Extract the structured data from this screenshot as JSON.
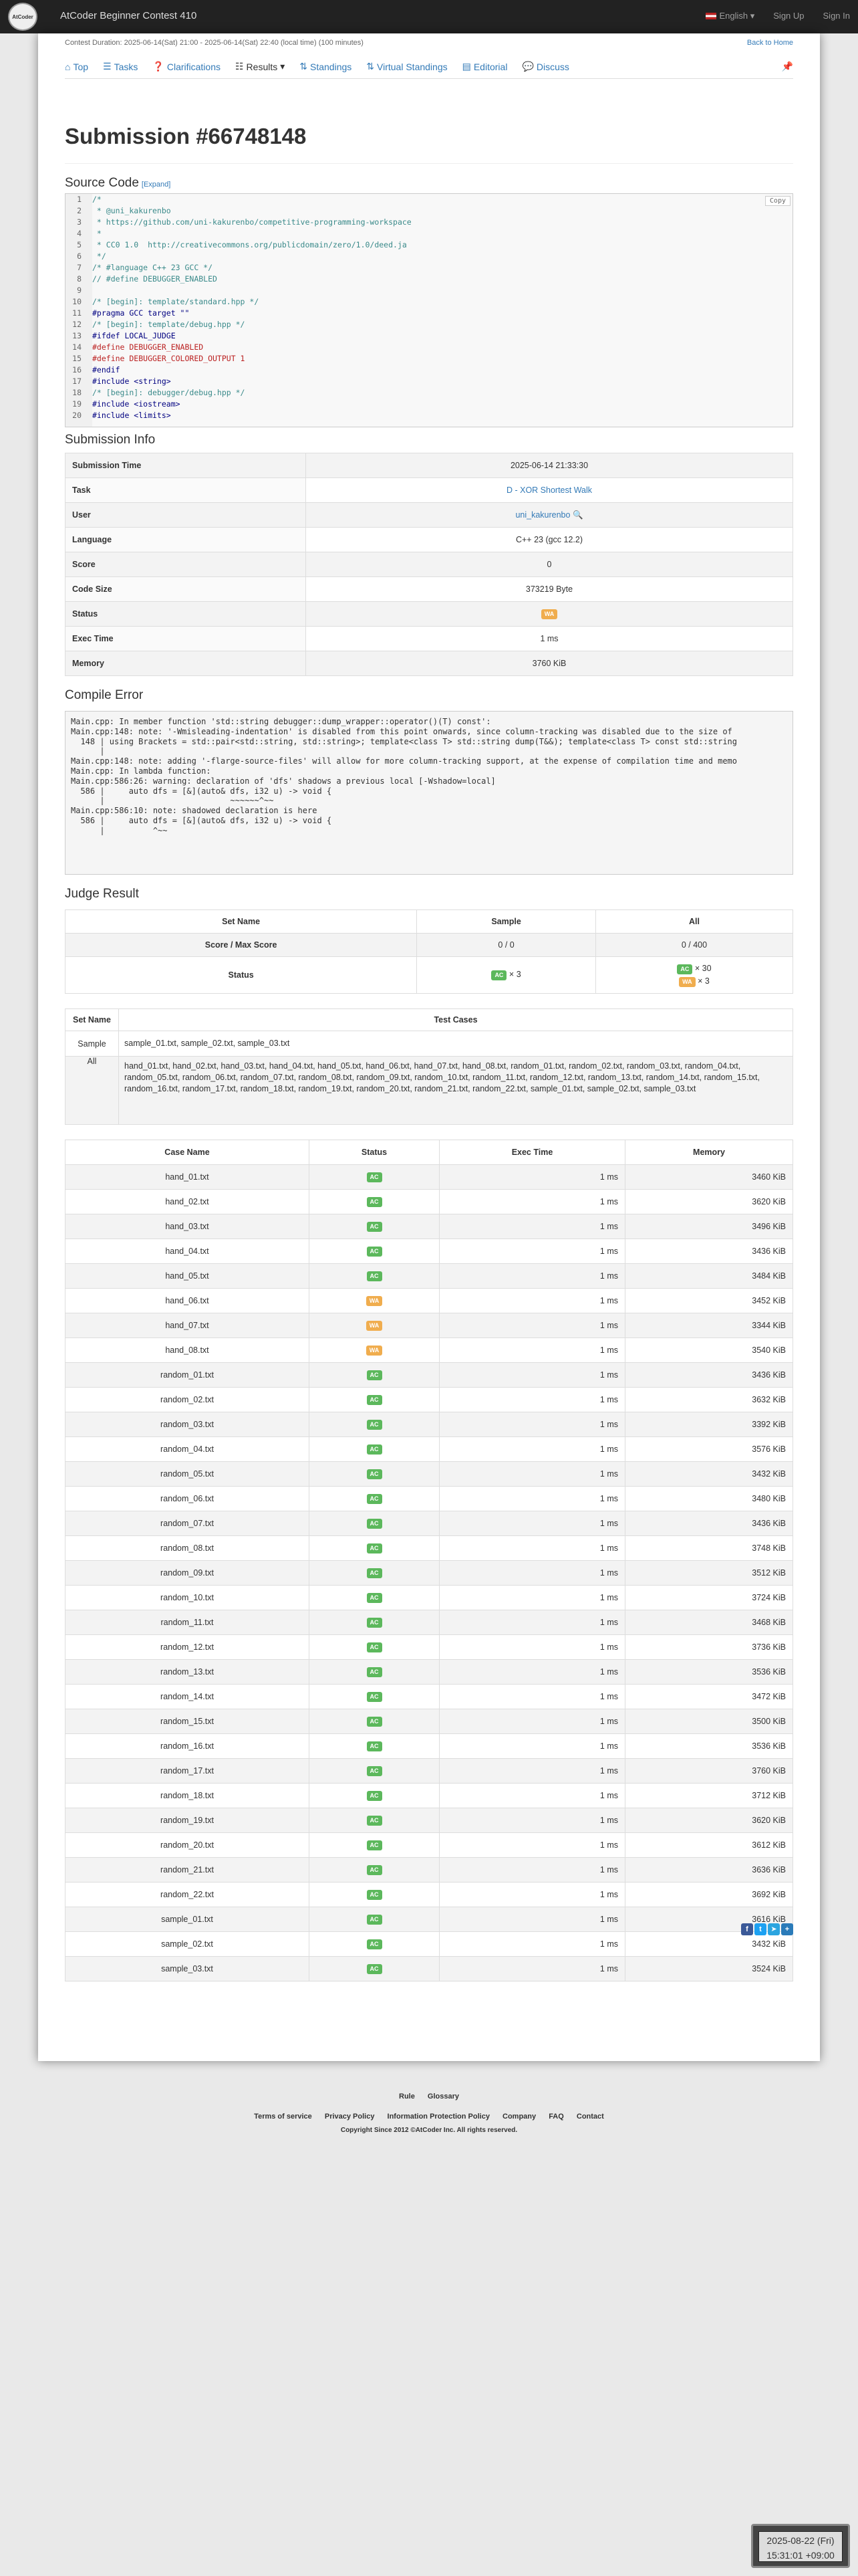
{
  "navbar": {
    "logo_text": "AtCoder",
    "contest_title": "AtCoder Beginner Contest 410",
    "language": "English",
    "sign_up": "Sign Up",
    "sign_in": "Sign In"
  },
  "header": {
    "duration": "Contest Duration: 2025-06-14(Sat) 21:00 - 2025-06-14(Sat) 22:40 (local time) (100 minutes)",
    "back_home": "Back to Home"
  },
  "tabs": [
    "Top",
    "Tasks",
    "Clarifications",
    "Results",
    "Standings",
    "Virtual Standings",
    "Editorial",
    "Discuss"
  ],
  "title": "Submission #66748148",
  "source_code": {
    "heading": "Source Code",
    "expand": "[Expand]",
    "copy": "Copy",
    "lines": [
      "/*",
      " * @uni_kakurenbo",
      " * https://github.com/uni-kakurenbo/competitive-programming-workspace",
      " *",
      " * CC0 1.0  http://creativecommons.org/publicdomain/zero/1.0/deed.ja",
      " */",
      "/* #language C++ 23 GCC */",
      "// #define DEBUGGER_ENABLED",
      "",
      "/* [begin]: template/standard.hpp */",
      "#pragma GCC target \"\"",
      "/* [begin]: template/debug.hpp */",
      "#ifdef LOCAL_JUDGE",
      "#define DEBUGGER_ENABLED",
      "#define DEBUGGER_COLORED_OUTPUT 1",
      "#endif",
      "#include <string>",
      "/* [begin]: debugger/debug.hpp */",
      "#include <iostream>",
      "#include <limits>"
    ]
  },
  "submission_info": {
    "heading": "Submission Info",
    "rows": [
      {
        "label": "Submission Time",
        "value": "2025-06-14 21:33:30"
      },
      {
        "label": "Task",
        "value": "D - XOR Shortest Walk"
      },
      {
        "label": "User",
        "value": "uni_kakurenbo"
      },
      {
        "label": "Language",
        "value": "C++ 23 (gcc 12.2)"
      },
      {
        "label": "Score",
        "value": "0"
      },
      {
        "label": "Code Size",
        "value": "373219 Byte"
      },
      {
        "label": "Status",
        "value": "WA"
      },
      {
        "label": "Exec Time",
        "value": "1 ms"
      },
      {
        "label": "Memory",
        "value": "3760 KiB"
      }
    ]
  },
  "compile_error": {
    "heading": "Compile Error",
    "text": "Main.cpp: In member function 'std::string debugger::dump_wrapper::operator()(T) const':\nMain.cpp:148: note: '-Wmisleading-indentation' is disabled from this point onwards, since column-tracking was disabled due to the size of\n  148 | using Brackets = std::pair<std::string, std::string>; template<class T> std::string dump(T&&); template<class T> const std::string\n      |\nMain.cpp:148: note: adding '-flarge-source-files' will allow for more column-tracking support, at the expense of compilation time and memo\nMain.cpp: In lambda function:\nMain.cpp:586:26: warning: declaration of 'dfs' shadows a previous local [-Wshadow=local]\n  586 |     auto dfs = [&](auto& dfs, i32 u) -> void {\n      |                          ~~~~~~^~~\nMain.cpp:586:10: note: shadowed declaration is here\n  586 |     auto dfs = [&](auto& dfs, i32 u) -> void {\n      |          ^~~"
  },
  "judge_result": {
    "heading": "Judge Result",
    "headers": [
      "Set Name",
      "Sample",
      "All"
    ],
    "score_label": "Score / Max Score",
    "score_sample": "0 / 0",
    "score_all": "0 / 400",
    "status_label": "Status",
    "sample_ac": "AC",
    "sample_ac_count": "× 3",
    "all_ac": "AC",
    "all_ac_count": "× 30",
    "all_wa": "WA",
    "all_wa_count": "× 3"
  },
  "test_sets": {
    "headers": [
      "Set Name",
      "Test Cases"
    ],
    "rows": [
      {
        "name": "Sample",
        "files": "sample_01.txt, sample_02.txt, sample_03.txt"
      },
      {
        "name": "All",
        "files": "hand_01.txt, hand_02.txt, hand_03.txt, hand_04.txt, hand_05.txt, hand_06.txt, hand_07.txt, hand_08.txt, random_01.txt, random_02.txt, random_03.txt, random_04.txt, random_05.txt, random_06.txt, random_07.txt, random_08.txt, random_09.txt, random_10.txt, random_11.txt, random_12.txt, random_13.txt, random_14.txt, random_15.txt, random_16.txt, random_17.txt, random_18.txt, random_19.txt, random_20.txt, random_21.txt, random_22.txt, sample_01.txt, sample_02.txt, sample_03.txt"
      }
    ]
  },
  "cases": {
    "headers": [
      "Case Name",
      "Status",
      "Exec Time",
      "Memory"
    ],
    "rows": [
      {
        "name": "hand_01.txt",
        "status": "AC",
        "time": "1 ms",
        "memory": "3460 KiB"
      },
      {
        "name": "hand_02.txt",
        "status": "AC",
        "time": "1 ms",
        "memory": "3620 KiB"
      },
      {
        "name": "hand_03.txt",
        "status": "AC",
        "time": "1 ms",
        "memory": "3496 KiB"
      },
      {
        "name": "hand_04.txt",
        "status": "AC",
        "time": "1 ms",
        "memory": "3436 KiB"
      },
      {
        "name": "hand_05.txt",
        "status": "AC",
        "time": "1 ms",
        "memory": "3484 KiB"
      },
      {
        "name": "hand_06.txt",
        "status": "WA",
        "time": "1 ms",
        "memory": "3452 KiB"
      },
      {
        "name": "hand_07.txt",
        "status": "WA",
        "time": "1 ms",
        "memory": "3344 KiB"
      },
      {
        "name": "hand_08.txt",
        "status": "WA",
        "time": "1 ms",
        "memory": "3540 KiB"
      },
      {
        "name": "random_01.txt",
        "status": "AC",
        "time": "1 ms",
        "memory": "3436 KiB"
      },
      {
        "name": "random_02.txt",
        "status": "AC",
        "time": "1 ms",
        "memory": "3632 KiB"
      },
      {
        "name": "random_03.txt",
        "status": "AC",
        "time": "1 ms",
        "memory": "3392 KiB"
      },
      {
        "name": "random_04.txt",
        "status": "AC",
        "time": "1 ms",
        "memory": "3576 KiB"
      },
      {
        "name": "random_05.txt",
        "status": "AC",
        "time": "1 ms",
        "memory": "3432 KiB"
      },
      {
        "name": "random_06.txt",
        "status": "AC",
        "time": "1 ms",
        "memory": "3480 KiB"
      },
      {
        "name": "random_07.txt",
        "status": "AC",
        "time": "1 ms",
        "memory": "3436 KiB"
      },
      {
        "name": "random_08.txt",
        "status": "AC",
        "time": "1 ms",
        "memory": "3748 KiB"
      },
      {
        "name": "random_09.txt",
        "status": "AC",
        "time": "1 ms",
        "memory": "3512 KiB"
      },
      {
        "name": "random_10.txt",
        "status": "AC",
        "time": "1 ms",
        "memory": "3724 KiB"
      },
      {
        "name": "random_11.txt",
        "status": "AC",
        "time": "1 ms",
        "memory": "3468 KiB"
      },
      {
        "name": "random_12.txt",
        "status": "AC",
        "time": "1 ms",
        "memory": "3736 KiB"
      },
      {
        "name": "random_13.txt",
        "status": "AC",
        "time": "1 ms",
        "memory": "3536 KiB"
      },
      {
        "name": "random_14.txt",
        "status": "AC",
        "time": "1 ms",
        "memory": "3472 KiB"
      },
      {
        "name": "random_15.txt",
        "status": "AC",
        "time": "1 ms",
        "memory": "3500 KiB"
      },
      {
        "name": "random_16.txt",
        "status": "AC",
        "time": "1 ms",
        "memory": "3536 KiB"
      },
      {
        "name": "random_17.txt",
        "status": "AC",
        "time": "1 ms",
        "memory": "3760 KiB"
      },
      {
        "name": "random_18.txt",
        "status": "AC",
        "time": "1 ms",
        "memory": "3712 KiB"
      },
      {
        "name": "random_19.txt",
        "status": "AC",
        "time": "1 ms",
        "memory": "3620 KiB"
      },
      {
        "name": "random_20.txt",
        "status": "AC",
        "time": "1 ms",
        "memory": "3612 KiB"
      },
      {
        "name": "random_21.txt",
        "status": "AC",
        "time": "1 ms",
        "memory": "3636 KiB"
      },
      {
        "name": "random_22.txt",
        "status": "AC",
        "time": "1 ms",
        "memory": "3692 KiB"
      },
      {
        "name": "sample_01.txt",
        "status": "AC",
        "time": "1 ms",
        "memory": "3616 KiB"
      },
      {
        "name": "sample_02.txt",
        "status": "AC",
        "time": "1 ms",
        "memory": "3432 KiB"
      },
      {
        "name": "sample_03.txt",
        "status": "AC",
        "time": "1 ms",
        "memory": "3524 KiB"
      }
    ]
  },
  "footer": {
    "links_row1": [
      "Rule",
      "Glossary"
    ],
    "links_row2": [
      "Terms of service",
      "Privacy Policy",
      "Information Protection Policy",
      "Company",
      "FAQ",
      "Contact"
    ],
    "copyright": "Copyright Since 2012 ©AtCoder Inc. All rights reserved."
  },
  "clock": {
    "date": "2025-08-22 (Fri)",
    "time": "15:31:01 +09:00"
  },
  "colors": {
    "ac": "#5cb85c",
    "wa": "#f0ad4e",
    "link": "#337ab7",
    "navbar": "#222222"
  }
}
